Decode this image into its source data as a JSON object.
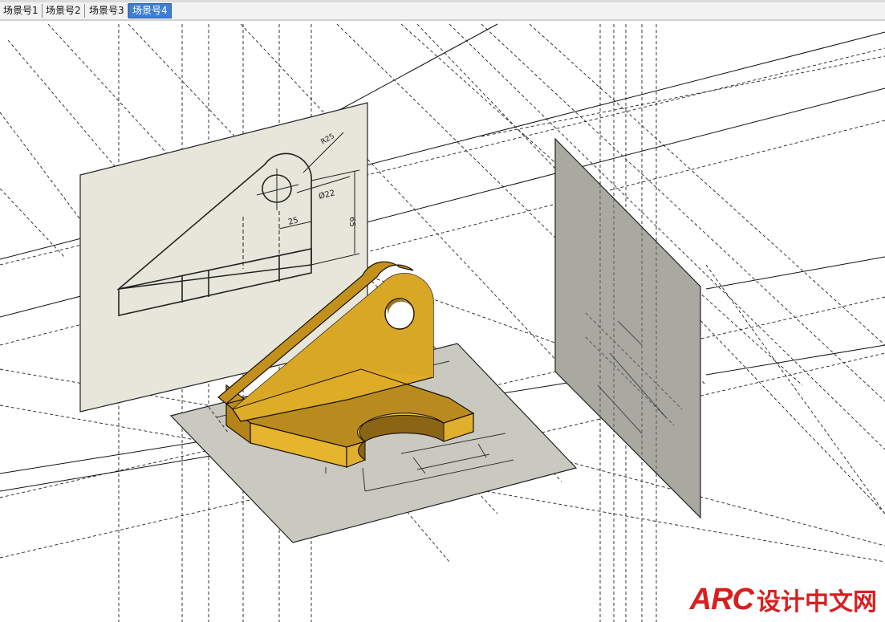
{
  "tabs": [
    {
      "label": "场景号1",
      "active": false
    },
    {
      "label": "场景号2",
      "active": false
    },
    {
      "label": "场景号3",
      "active": false
    },
    {
      "label": "场景号4",
      "active": true
    }
  ],
  "drawing": {
    "dims": {
      "radius": "R25",
      "hole_diameter": "Ø22",
      "offset": "25",
      "height": "65"
    }
  },
  "colors": {
    "part_face": "#e2b330",
    "part_side": "#b98b1f",
    "plane_fill": "#e6e6da",
    "active_tab": "#3d7fd6",
    "watermark": "#d91f1f"
  },
  "watermark": {
    "brand": "ARC",
    "text": "设计中文网"
  }
}
